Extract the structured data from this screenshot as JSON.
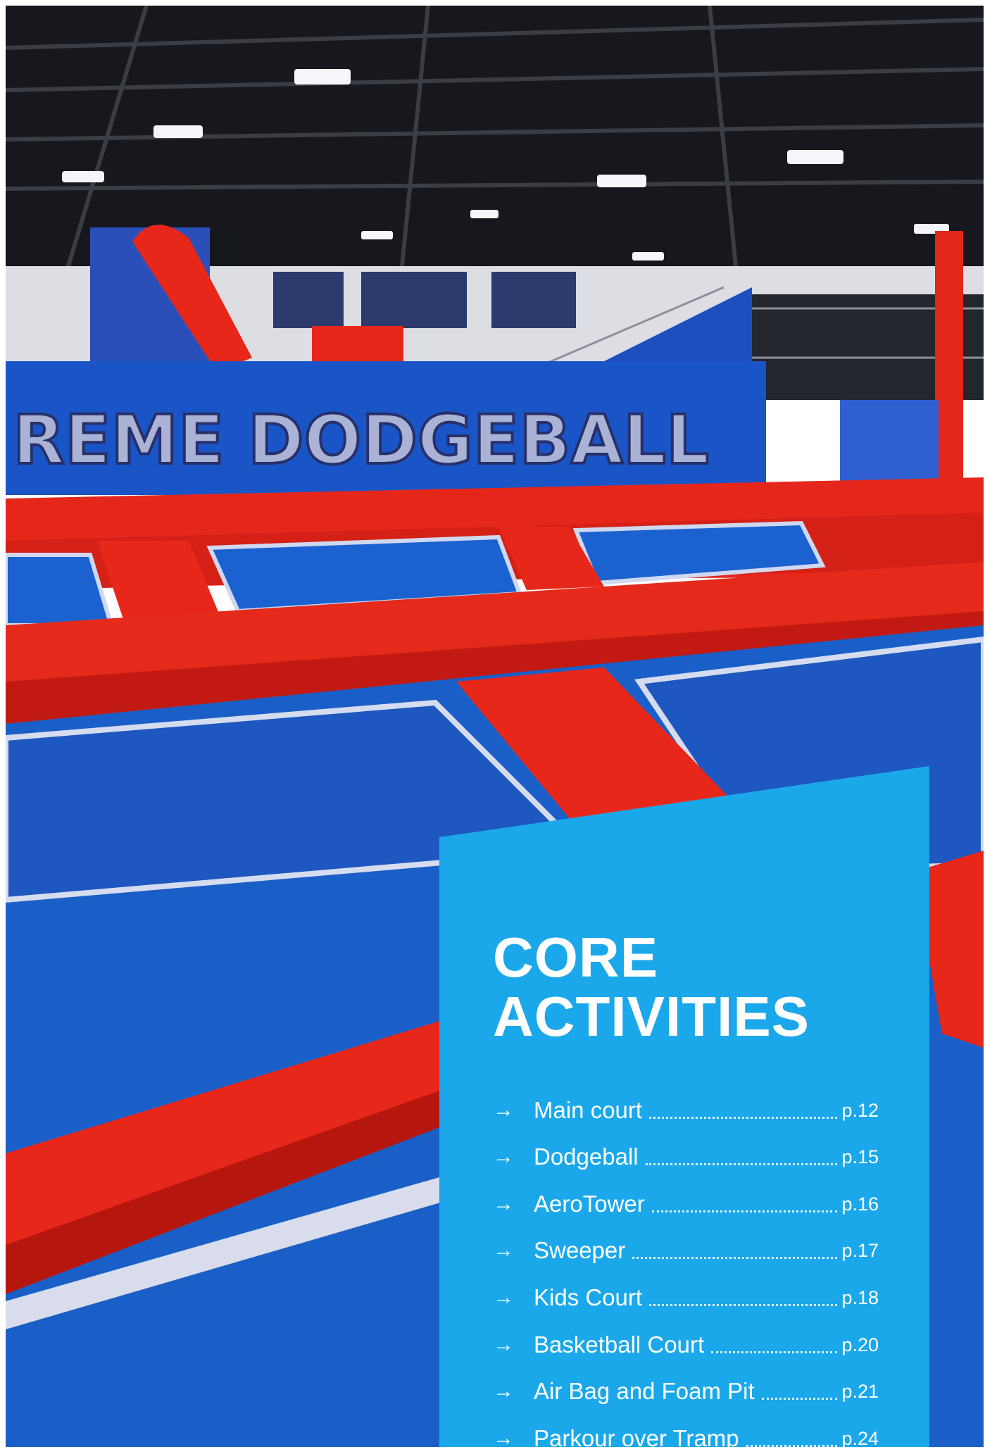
{
  "photo": {
    "banner_text": "REME DODGEBALL",
    "colors": {
      "court_blue": "#1a5fc7",
      "pad_red": "#e8271b",
      "ceiling": "#1b1d22",
      "wall": "#d9dbe0"
    }
  },
  "panel": {
    "color": "#1aa8ea",
    "title_line1": "CORE",
    "title_line2": "ACTIVITIES"
  },
  "toc": [
    {
      "label": "Main court",
      "page": "p.12"
    },
    {
      "label": "Dodgeball",
      "page": "p.15"
    },
    {
      "label": "AeroTower",
      "page": "p.16"
    },
    {
      "label": "Sweeper",
      "page": "p.17"
    },
    {
      "label": "Kids Court",
      "page": "p.18"
    },
    {
      "label": "Basketball Court",
      "page": "p.20"
    },
    {
      "label": "Air Bag and Foam Pit",
      "page": "p.21"
    },
    {
      "label": "Parkour over Tramp",
      "page": "p.24"
    }
  ],
  "toc_arrow": "→"
}
